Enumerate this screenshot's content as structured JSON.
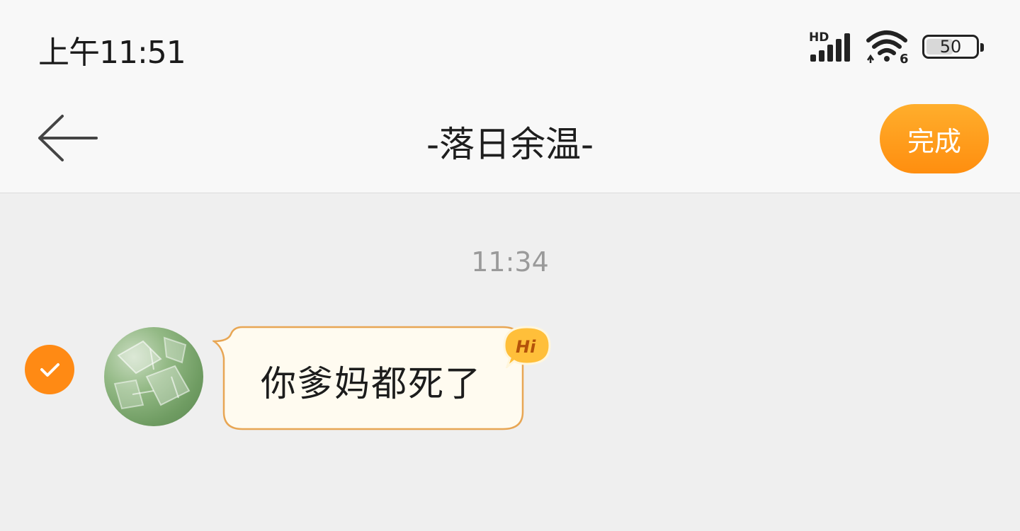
{
  "status_bar": {
    "time": "上午11:51",
    "network_label": "HD",
    "wifi_label": "6",
    "battery_level": "50"
  },
  "header": {
    "title": "-落日余温-",
    "done_label": "完成"
  },
  "chat": {
    "timestamp": "11:34",
    "messages": [
      {
        "text": "你爹妈都死了",
        "selected": true,
        "badge": "Hi"
      }
    ]
  },
  "colors": {
    "accent": "#ff8a14",
    "bubble_bg": "#fffbf0",
    "bubble_border": "#e8a654",
    "page_bg": "#efefef",
    "header_bg": "#f8f8f8"
  }
}
